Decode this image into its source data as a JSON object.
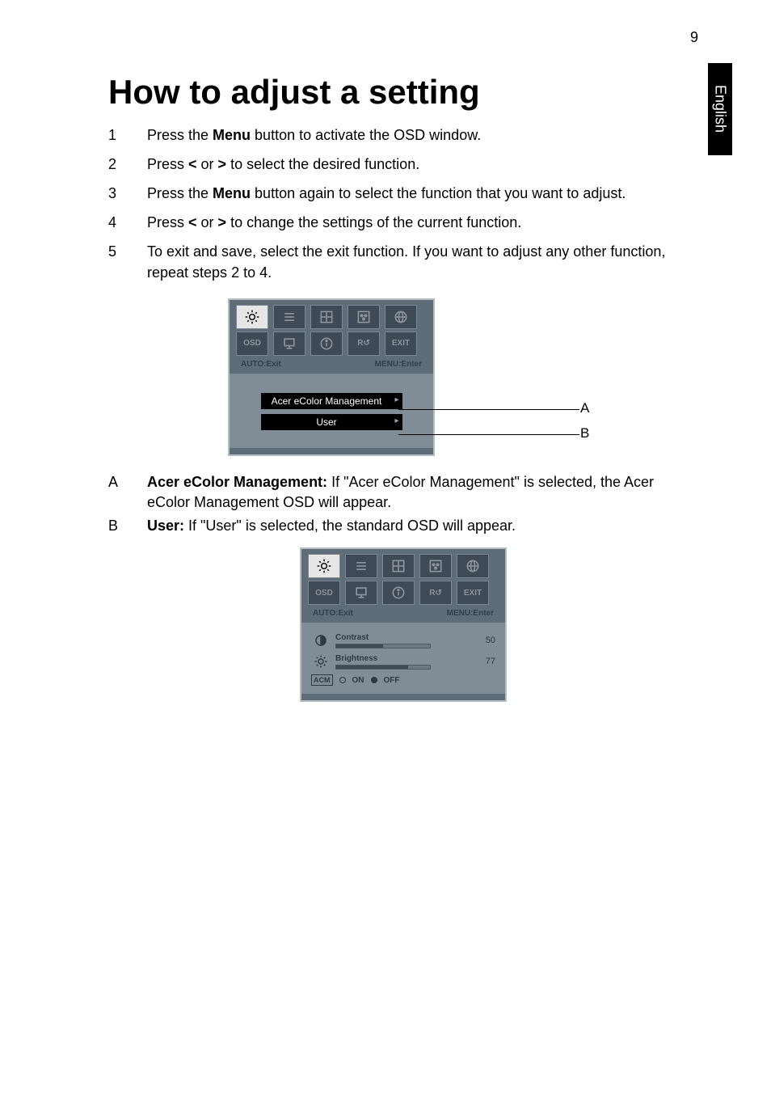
{
  "page_number": "9",
  "language_tab": "English",
  "title": "How to adjust a setting",
  "steps": [
    {
      "before": "Press the ",
      "bold": "Menu",
      "after": " button to activate the OSD window."
    },
    {
      "before": "Press ",
      "bold1": "<",
      "mid": " or ",
      "bold2": ">",
      "after": " to select the desired function."
    },
    {
      "before": "Press the ",
      "bold": "Menu",
      "after": " button again to select the function that you want to adjust."
    },
    {
      "before": "Press ",
      "bold1": "<",
      "mid": " or ",
      "bold2": ">",
      "after": " to change the settings of the current function."
    },
    {
      "text": "To exit and save, select the exit function. If you want to adjust any other function, repeat steps 2 to 4."
    }
  ],
  "osd": {
    "hint_left": "AUTO:Exit",
    "hint_right": "MENU:Enter",
    "menu_a": "Acer eColor Management",
    "menu_b": "User",
    "row2_labels": {
      "osd": "OSD",
      "reset": "R",
      "exit": "EXIT"
    }
  },
  "callout_a": "A",
  "callout_b": "B",
  "explain": {
    "a_marker": "A",
    "a_bold": "Acer eColor Management:",
    "a_text": " If \"Acer eColor Management\" is selected, the Acer eColor Management OSD will appear.",
    "b_marker": "B",
    "b_bold": "User:",
    "b_text": " If \"User\" is selected, the standard OSD will appear."
  },
  "osd2": {
    "contrast_label": "Contrast",
    "contrast_value": "50",
    "brightness_label": "Brightness",
    "brightness_value": "77",
    "acm": "ACM",
    "on": "ON",
    "off": "OFF"
  },
  "chart_data": {
    "type": "table",
    "title": "OSD slider values",
    "rows": [
      {
        "name": "Contrast",
        "value": 50,
        "range": [
          0,
          100
        ]
      },
      {
        "name": "Brightness",
        "value": 77,
        "range": [
          0,
          100
        ]
      },
      {
        "name": "ACM",
        "value": "OFF",
        "options": [
          "ON",
          "OFF"
        ]
      }
    ]
  }
}
